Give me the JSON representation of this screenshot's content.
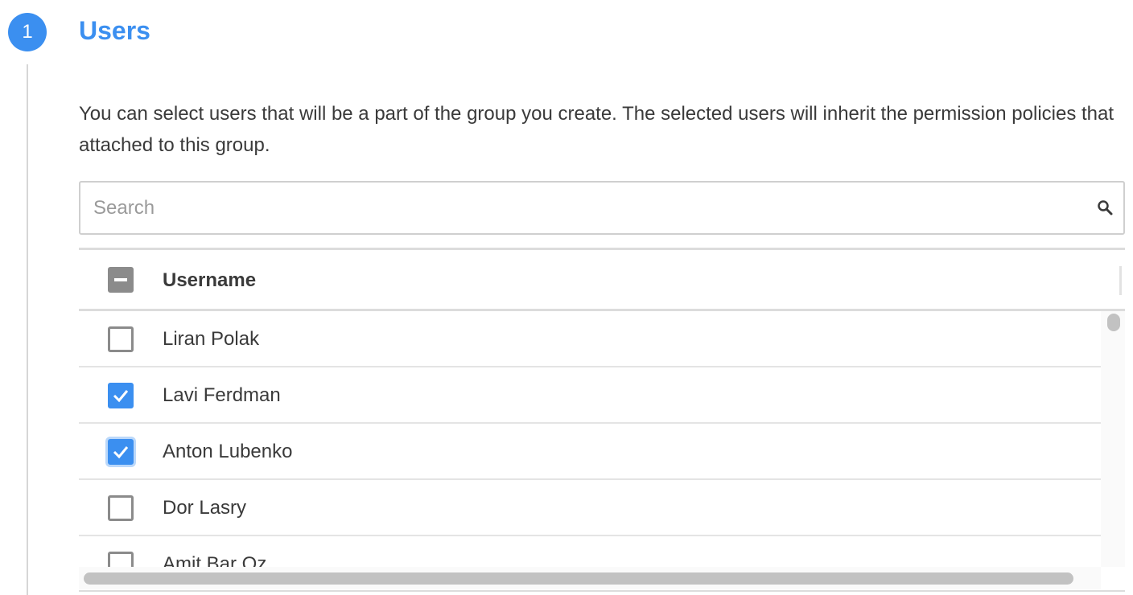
{
  "step": {
    "number": "1",
    "title": "Users"
  },
  "description": "You can select users that will be a part of the group you create. The selected users will inherit the permission policies that attached to this group.",
  "search": {
    "placeholder": "Search",
    "value": ""
  },
  "table": {
    "column_header": "Username",
    "header_checkbox_state": "indeterminate",
    "rows": [
      {
        "username": "Liran Polak",
        "checked": false
      },
      {
        "username": "Lavi Ferdman",
        "checked": true
      },
      {
        "username": "Anton Lubenko",
        "checked": true,
        "focused": true
      },
      {
        "username": "Dor Lasry",
        "checked": false
      },
      {
        "username": "Amit Bar Oz",
        "checked": false
      }
    ]
  },
  "colors": {
    "accent": "#3b8ff0",
    "checkbox_border": "#8b8b8b"
  },
  "icons": {
    "search": "search-icon",
    "check": "checkmark-icon"
  }
}
